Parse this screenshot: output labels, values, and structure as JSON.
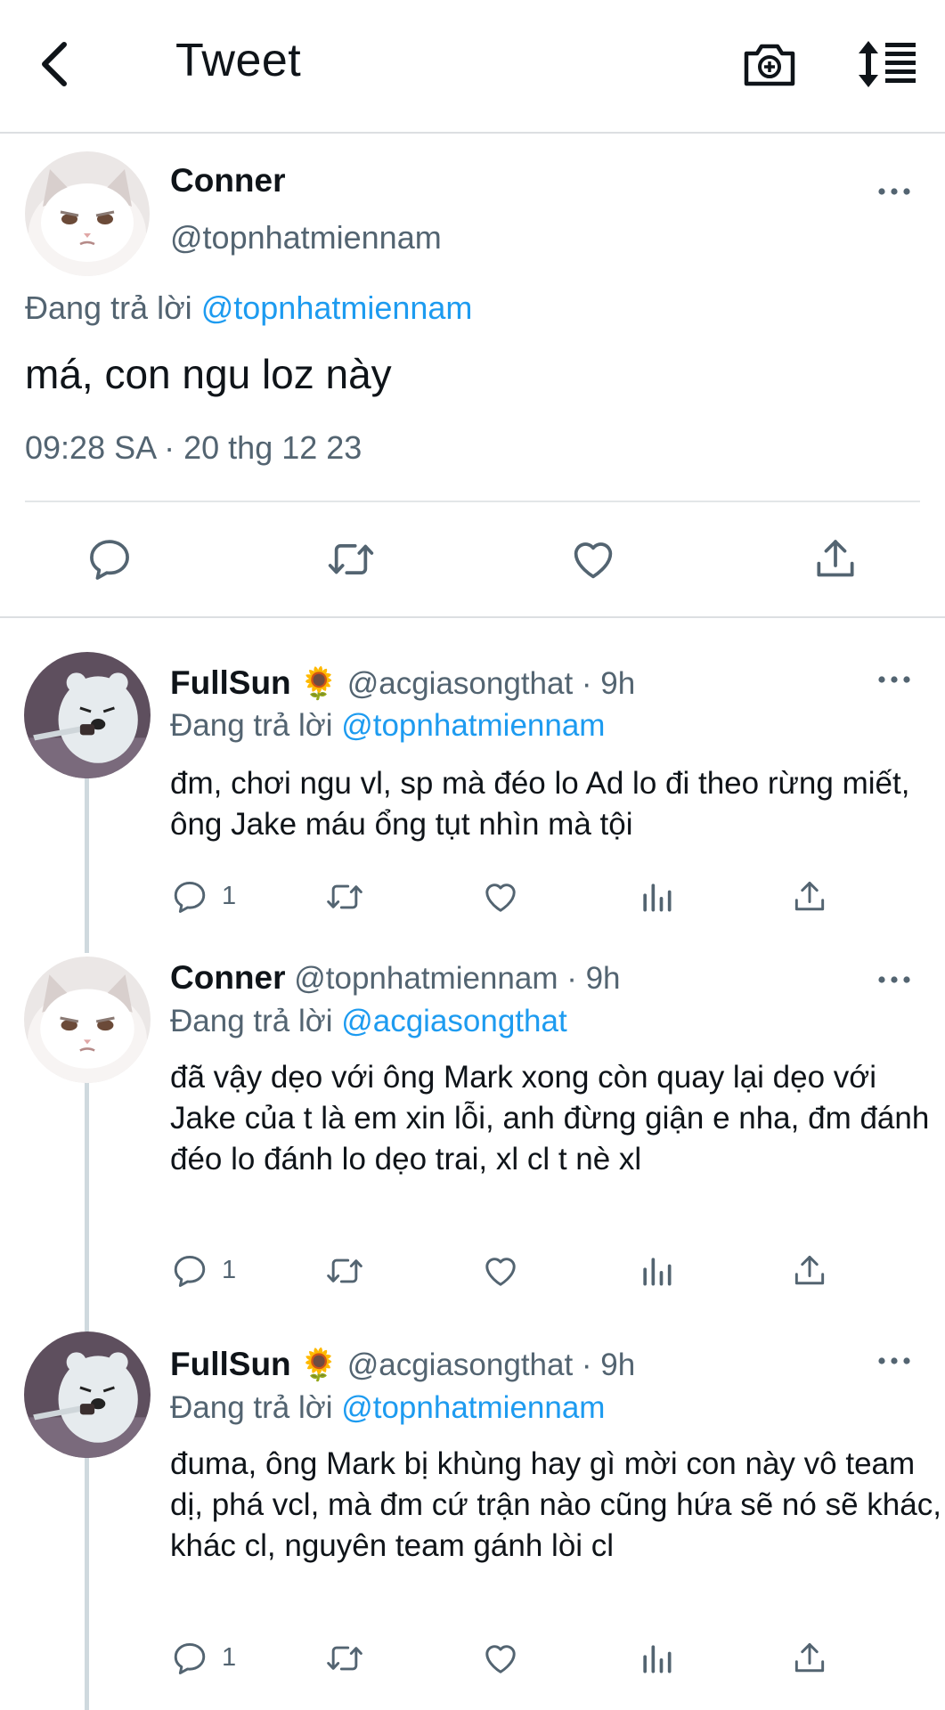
{
  "header": {
    "title": "Tweet"
  },
  "main_tweet": {
    "name": "Conner",
    "handle": "@topnhatmiennam",
    "replying_prefix": "Đang trả lời",
    "replying_to": "@topnhatmiennam",
    "text": "má, con ngu loz này",
    "timestamp": "09:28 SA · 20 thg 12 23"
  },
  "replies": [
    {
      "name": "FullSun",
      "emoji": "🌻",
      "handle_time": "@acgiasongthat · 9h",
      "replying_prefix": "Đang trả lời",
      "replying_to": "@topnhatmiennam",
      "text": "đm, chơi ngu vl, sp mà đéo lo Ad lo đi theo rừng miết, ông Jake máu ổng tụt nhìn mà tội",
      "reply_count": "1"
    },
    {
      "name": "Conner",
      "emoji": "",
      "handle_time": "@topnhatmiennam · 9h",
      "replying_prefix": "Đang trả lời",
      "replying_to": "@acgiasongthat",
      "text": "đã vậy dẹo với ông Mark xong còn quay lại dẹo với Jake của t là em xin lỗi, anh đừng giận e nha, đm đánh đéo lo đánh lo dẹo trai, xl cl t nè xl",
      "reply_count": "1"
    },
    {
      "name": "FullSun",
      "emoji": "🌻",
      "handle_time": "@acgiasongthat · 9h",
      "replying_prefix": "Đang trả lời",
      "replying_to": "@topnhatmiennam",
      "text": "đuma, ông Mark bị khùng hay gì mời con này vô team dị, phá vcl, mà đm cứ trận nào cũng hứa sẽ nó sẽ khác, khác cl, nguyên team gánh lòi cl",
      "reply_count": "1"
    }
  ],
  "colors": {
    "accent": "#1d9bf0",
    "secondary_text": "#536471",
    "primary_text": "#0f1419",
    "divider": "#e3e6e8"
  },
  "icons": [
    "back-arrow-icon",
    "camera-add-icon",
    "sort-icon",
    "more-icon",
    "reply-icon",
    "retweet-icon",
    "like-icon",
    "views-icon",
    "share-icon"
  ]
}
